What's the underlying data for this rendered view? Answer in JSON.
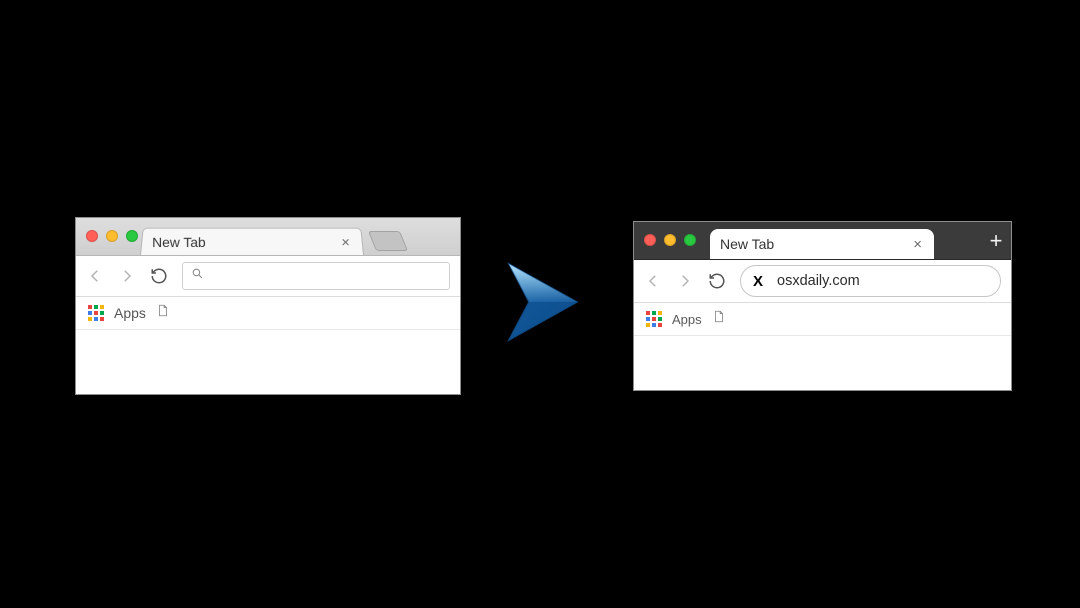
{
  "left_window": {
    "theme": "light",
    "tab": {
      "title": "New Tab",
      "close_label": "×"
    },
    "toolbar": {
      "back_enabled": false,
      "forward_enabled": false,
      "reload_enabled": true,
      "omnibox_value": "",
      "omnibox_placeholder": ""
    },
    "bookmarks": {
      "apps_label": "Apps",
      "apps_colors": [
        "#e8433f",
        "#00a650",
        "#f2b50c",
        "#3f7ee8",
        "#e8433f",
        "#00a650",
        "#f2b50c",
        "#3f7ee8",
        "#e8433f"
      ]
    }
  },
  "right_window": {
    "theme": "dark",
    "tab": {
      "title": "New Tab",
      "close_label": "×"
    },
    "new_tab_label": "+",
    "toolbar": {
      "back_enabled": false,
      "forward_enabled": false,
      "reload_enabled": true,
      "omnibox_value": "osxdaily.com",
      "favicon_letter": "X"
    },
    "bookmarks": {
      "apps_label": "Apps",
      "apps_colors": [
        "#e8433f",
        "#00a650",
        "#f2b50c",
        "#3f7ee8",
        "#e8433f",
        "#00a650",
        "#f2b50c",
        "#3f7ee8",
        "#e8433f"
      ]
    }
  }
}
